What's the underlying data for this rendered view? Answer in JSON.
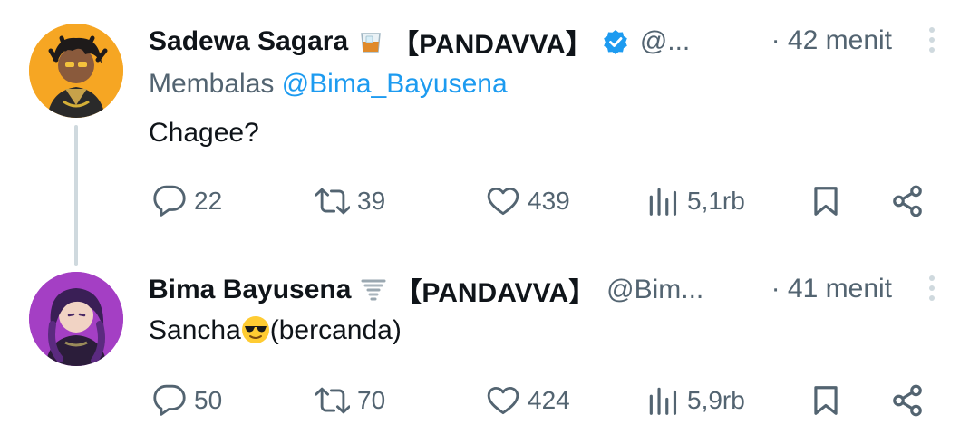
{
  "colors": {
    "text": "#0f1419",
    "secondary": "#536471",
    "link": "#1d9bf0",
    "verified": "#1d9bf0",
    "thread_line": "#cfd9de"
  },
  "tweets": [
    {
      "author": {
        "name": "Sadewa Sagara",
        "name_emoji": "tumbler-glass-emoji",
        "suffix": "【PANDAVVA】",
        "verified": true,
        "handle": "@..."
      },
      "time": "· 42 menit",
      "reply_to": {
        "prefix": "Membalas ",
        "mention": "@Bima_Bayusena"
      },
      "text": "Chagee?",
      "stats": {
        "replies": "22",
        "reposts": "39",
        "likes": "439",
        "views": "5,1rb"
      }
    },
    {
      "author": {
        "name": "Bima Bayusena",
        "name_emoji": "tornado-emoji",
        "suffix": "【PANDAVVA】",
        "verified": false,
        "handle": "@Bim..."
      },
      "time": "· 41 menit",
      "text_before": "Sancha",
      "text_emoji": "sunglasses-face-emoji",
      "text_after": "(bercanda)",
      "stats": {
        "replies": "50",
        "reposts": "70",
        "likes": "424",
        "views": "5,9rb"
      }
    }
  ]
}
